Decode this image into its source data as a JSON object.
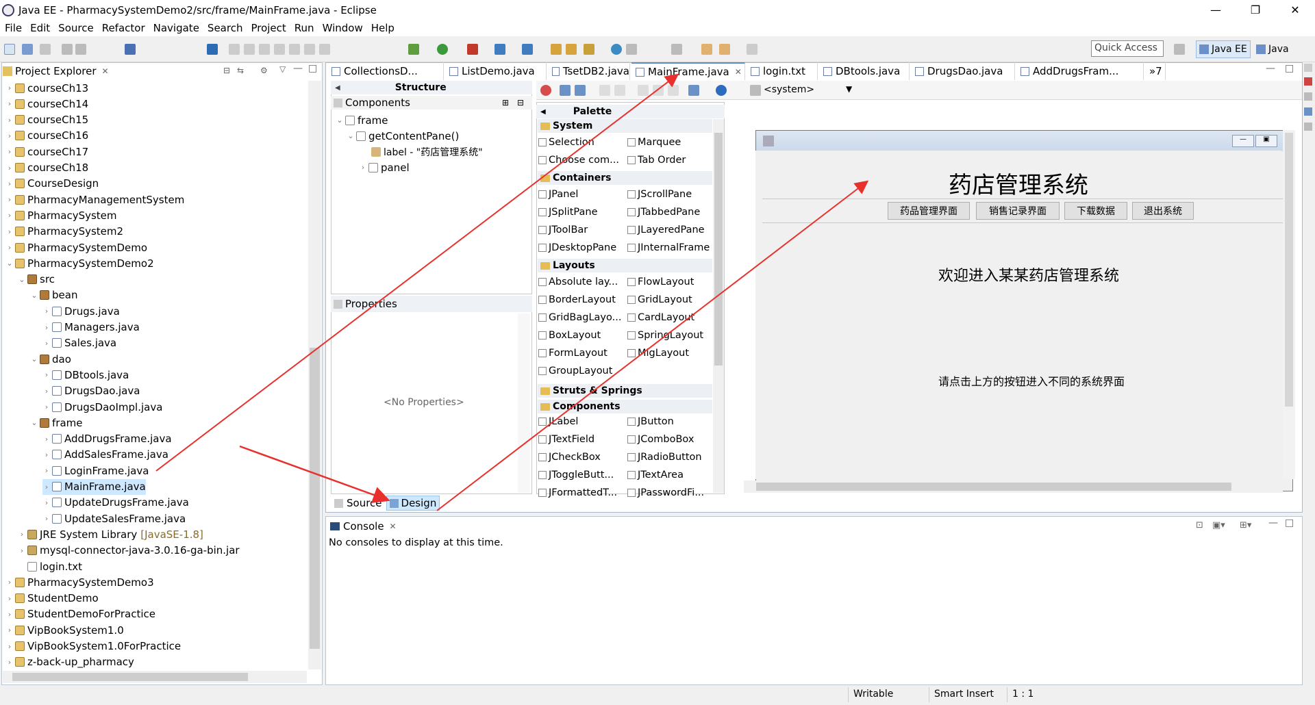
{
  "window": {
    "title": "Java EE - PharmacySystemDemo2/src/frame/MainFrame.java - Eclipse"
  },
  "menu": [
    "File",
    "Edit",
    "Source",
    "Refactor",
    "Navigate",
    "Search",
    "Project",
    "Run",
    "Window",
    "Help"
  ],
  "toolbar": {
    "quick_access_placeholder": "Quick Access",
    "perspective_javaee": "Java EE",
    "perspective_java": "Java"
  },
  "project_explorer": {
    "title": "Project Explorer",
    "items": [
      {
        "label": "courseCh13"
      },
      {
        "label": "courseCh14"
      },
      {
        "label": "courseCh15"
      },
      {
        "label": "courseCh16"
      },
      {
        "label": "courseCh17"
      },
      {
        "label": "courseCh18"
      },
      {
        "label": "CourseDesign"
      },
      {
        "label": "PharmacyManagementSystem"
      },
      {
        "label": "PharmacySystem"
      },
      {
        "label": "PharmacySystem2"
      },
      {
        "label": "PharmacySystemDemo"
      },
      {
        "label": "PharmacySystemDemo2"
      },
      {
        "label": "src"
      },
      {
        "label": "bean"
      },
      {
        "label": "Drugs.java"
      },
      {
        "label": "Managers.java"
      },
      {
        "label": "Sales.java"
      },
      {
        "label": "dao"
      },
      {
        "label": "DBtools.java"
      },
      {
        "label": "DrugsDao.java"
      },
      {
        "label": "DrugsDaoImpl.java"
      },
      {
        "label": "frame"
      },
      {
        "label": "AddDrugsFrame.java"
      },
      {
        "label": "AddSalesFrame.java"
      },
      {
        "label": "LoginFrame.java"
      },
      {
        "label": "MainFrame.java"
      },
      {
        "label": "UpdateDrugsFrame.java"
      },
      {
        "label": "UpdateSalesFrame.java"
      },
      {
        "label": "JRE System Library",
        "suffix": "[JavaSE-1.8]"
      },
      {
        "label": "mysql-connector-java-3.0.16-ga-bin.jar"
      },
      {
        "label": "login.txt"
      },
      {
        "label": "PharmacySystemDemo3"
      },
      {
        "label": "StudentDemo"
      },
      {
        "label": "StudentDemoForPractice"
      },
      {
        "label": "VipBookSystem1.0"
      },
      {
        "label": "VipBookSystem1.0ForPractice"
      },
      {
        "label": "z-back-up_pharmacy"
      }
    ]
  },
  "editor_tabs": [
    "CollectionsD...",
    "ListDemo.java",
    "TsetDB2.java",
    "MainFrame.java",
    "login.txt",
    "DBtools.java",
    "DrugsDao.java",
    "AddDrugsFram...",
    "»7"
  ],
  "structure": {
    "title": "Structure",
    "components_label": "Components",
    "tree": [
      "frame",
      "getContentPane()",
      "label - \"药店管理系统\"",
      "panel"
    ]
  },
  "properties": {
    "title": "Properties",
    "empty": "<No Properties>"
  },
  "palette": {
    "title": "Palette",
    "system_combo": "<system>",
    "groups": {
      "system": "System",
      "containers": "Containers",
      "layouts": "Layouts",
      "struts": "Struts & Springs",
      "components": "Components"
    },
    "system_items": [
      "Selection",
      "Marquee",
      "Choose com...",
      "Tab Order"
    ],
    "container_items": [
      "JPanel",
      "JScrollPane",
      "JSplitPane",
      "JTabbedPane",
      "JToolBar",
      "JLayeredPane",
      "JDesktopPane",
      "JInternalFrame"
    ],
    "layout_items": [
      "Absolute lay...",
      "FlowLayout",
      "BorderLayout",
      "GridLayout",
      "GridBagLayo...",
      "CardLayout",
      "BoxLayout",
      "SpringLayout",
      "FormLayout",
      "MigLayout",
      "GroupLayout"
    ],
    "component_items": [
      "JLabel",
      "JButton",
      "JTextField",
      "JComboBox",
      "JCheckBox",
      "JRadioButton",
      "JToggleButt...",
      "JTextArea",
      "JFormattedT...",
      "JPasswordFi..."
    ]
  },
  "design_frame": {
    "title": "药店管理系统",
    "buttons": [
      "药品管理界面",
      "销售记录界面",
      "下载数据",
      "退出系统"
    ],
    "welcome": "欢迎进入某某药店管理系统",
    "hint": "请点击上方的按钮进入不同的系统界面"
  },
  "bottom_tabs": {
    "source": "Source",
    "design": "Design"
  },
  "console": {
    "title": "Console",
    "message": "No consoles to display at this time."
  },
  "statusbar": {
    "writable": "Writable",
    "insert": "Smart Insert",
    "position": "1 : 1"
  },
  "colors": {
    "arrow": "#e8302c",
    "selection": "#cde8ff",
    "panel_border": "#b9c5d3"
  }
}
